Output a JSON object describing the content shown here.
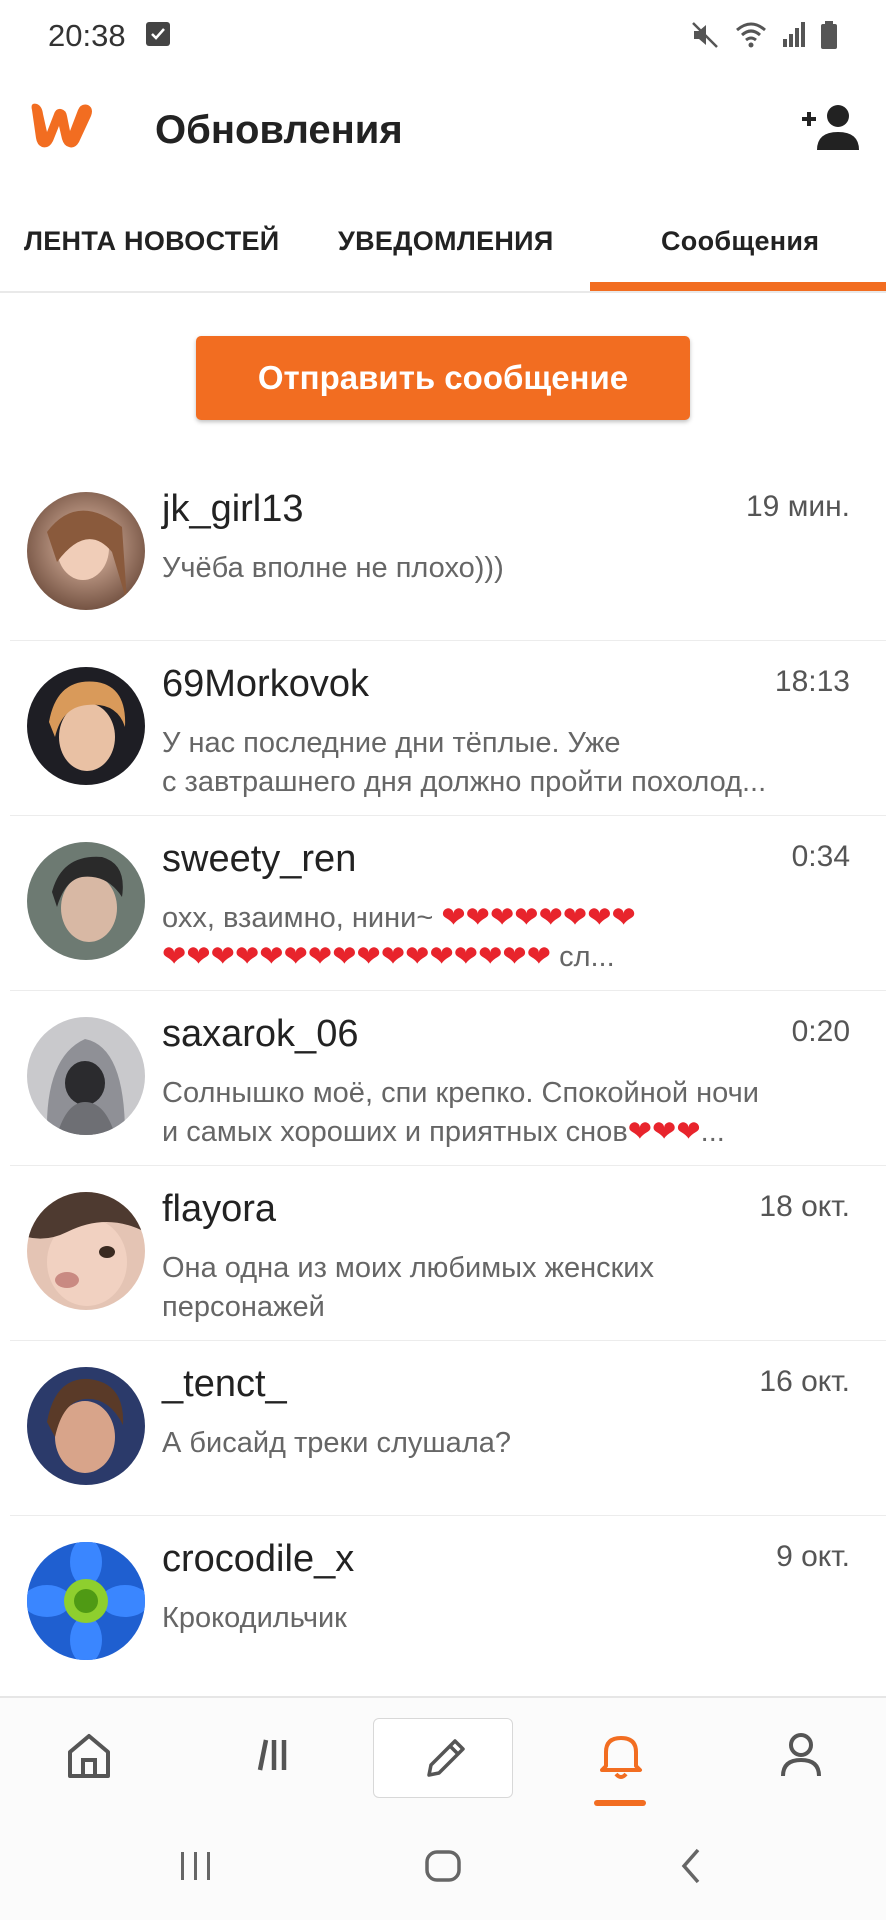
{
  "status_bar": {
    "time": "20:38",
    "icons": [
      "check-notification-icon",
      "mute-icon",
      "wifi-icon",
      "signal-icon",
      "battery-icon"
    ]
  },
  "header": {
    "title": "Обновления",
    "logo": "wattpad-logo",
    "action_icon": "add-user-icon"
  },
  "tabs": [
    {
      "label": "ЛЕНТА НОВОСТЕЙ",
      "active": false
    },
    {
      "label": "УВЕДОМЛЕНИЯ",
      "active": false
    },
    {
      "label": "Сообщения",
      "active": true
    }
  ],
  "send_button": {
    "label": "Отправить сообщение"
  },
  "conversations": [
    {
      "name": "jk_girl13",
      "time": "19 мин.",
      "preview": "Учёба вполне не плохо)))"
    },
    {
      "name": "69Morkovok",
      "time": "18:13",
      "preview": "У нас последние дни тёплые. Уже\nс завтрашнего дня должно пройти похолод..."
    },
    {
      "name": "sweety_ren",
      "time": "0:34",
      "preview": "охх, взаимно, нини~ ❤❤❤❤❤❤❤❤\n❤❤❤❤❤❤❤❤❤❤❤❤❤❤❤❤ сл..."
    },
    {
      "name": "saxarok_06",
      "time": "0:20",
      "preview": "Солнышко моё, спи крепко. Спокойной ночи\nи самых хороших и приятных снов❤❤❤..."
    },
    {
      "name": "flayora",
      "time": "18 окт.",
      "preview": "Она одна из моих любимых женских\nперсонажей"
    },
    {
      "name": "_tenct_",
      "time": "16 окт.",
      "preview": "А бисайд треки слушала?"
    },
    {
      "name": "crocodile_x",
      "time": "9 окт.",
      "preview": "Крокодильчик"
    }
  ],
  "bottom_nav": {
    "items": [
      "home-icon",
      "library-icon",
      "write-icon",
      "notifications-icon",
      "profile-icon"
    ],
    "active": "notifications-icon"
  },
  "colors": {
    "accent": "#f26d21",
    "text_primary": "#222222",
    "text_secondary": "#666666"
  }
}
